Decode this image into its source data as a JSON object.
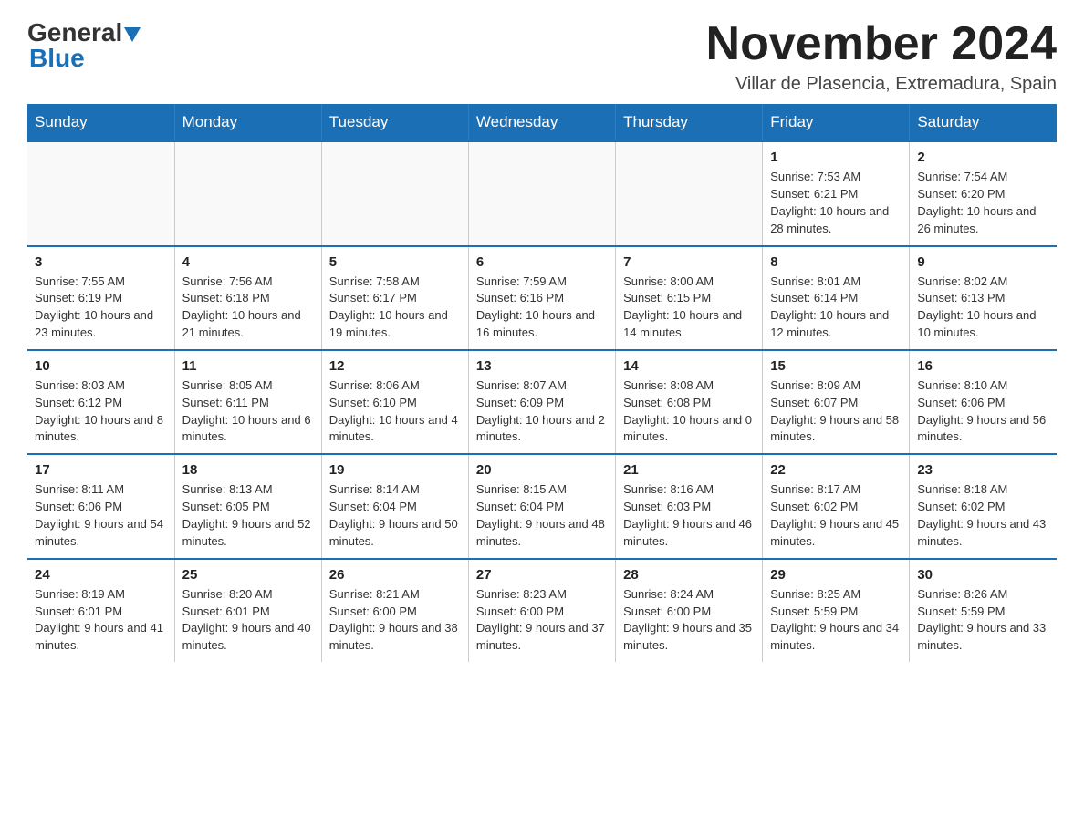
{
  "logo": {
    "general": "General",
    "blue": "Blue",
    "arrow": "▼"
  },
  "title": "November 2024",
  "location": "Villar de Plasencia, Extremadura, Spain",
  "weekdays": [
    "Sunday",
    "Monday",
    "Tuesday",
    "Wednesday",
    "Thursday",
    "Friday",
    "Saturday"
  ],
  "weeks": [
    [
      {
        "day": "",
        "info": ""
      },
      {
        "day": "",
        "info": ""
      },
      {
        "day": "",
        "info": ""
      },
      {
        "day": "",
        "info": ""
      },
      {
        "day": "",
        "info": ""
      },
      {
        "day": "1",
        "info": "Sunrise: 7:53 AM\nSunset: 6:21 PM\nDaylight: 10 hours and 28 minutes."
      },
      {
        "day": "2",
        "info": "Sunrise: 7:54 AM\nSunset: 6:20 PM\nDaylight: 10 hours and 26 minutes."
      }
    ],
    [
      {
        "day": "3",
        "info": "Sunrise: 7:55 AM\nSunset: 6:19 PM\nDaylight: 10 hours and 23 minutes."
      },
      {
        "day": "4",
        "info": "Sunrise: 7:56 AM\nSunset: 6:18 PM\nDaylight: 10 hours and 21 minutes."
      },
      {
        "day": "5",
        "info": "Sunrise: 7:58 AM\nSunset: 6:17 PM\nDaylight: 10 hours and 19 minutes."
      },
      {
        "day": "6",
        "info": "Sunrise: 7:59 AM\nSunset: 6:16 PM\nDaylight: 10 hours and 16 minutes."
      },
      {
        "day": "7",
        "info": "Sunrise: 8:00 AM\nSunset: 6:15 PM\nDaylight: 10 hours and 14 minutes."
      },
      {
        "day": "8",
        "info": "Sunrise: 8:01 AM\nSunset: 6:14 PM\nDaylight: 10 hours and 12 minutes."
      },
      {
        "day": "9",
        "info": "Sunrise: 8:02 AM\nSunset: 6:13 PM\nDaylight: 10 hours and 10 minutes."
      }
    ],
    [
      {
        "day": "10",
        "info": "Sunrise: 8:03 AM\nSunset: 6:12 PM\nDaylight: 10 hours and 8 minutes."
      },
      {
        "day": "11",
        "info": "Sunrise: 8:05 AM\nSunset: 6:11 PM\nDaylight: 10 hours and 6 minutes."
      },
      {
        "day": "12",
        "info": "Sunrise: 8:06 AM\nSunset: 6:10 PM\nDaylight: 10 hours and 4 minutes."
      },
      {
        "day": "13",
        "info": "Sunrise: 8:07 AM\nSunset: 6:09 PM\nDaylight: 10 hours and 2 minutes."
      },
      {
        "day": "14",
        "info": "Sunrise: 8:08 AM\nSunset: 6:08 PM\nDaylight: 10 hours and 0 minutes."
      },
      {
        "day": "15",
        "info": "Sunrise: 8:09 AM\nSunset: 6:07 PM\nDaylight: 9 hours and 58 minutes."
      },
      {
        "day": "16",
        "info": "Sunrise: 8:10 AM\nSunset: 6:06 PM\nDaylight: 9 hours and 56 minutes."
      }
    ],
    [
      {
        "day": "17",
        "info": "Sunrise: 8:11 AM\nSunset: 6:06 PM\nDaylight: 9 hours and 54 minutes."
      },
      {
        "day": "18",
        "info": "Sunrise: 8:13 AM\nSunset: 6:05 PM\nDaylight: 9 hours and 52 minutes."
      },
      {
        "day": "19",
        "info": "Sunrise: 8:14 AM\nSunset: 6:04 PM\nDaylight: 9 hours and 50 minutes."
      },
      {
        "day": "20",
        "info": "Sunrise: 8:15 AM\nSunset: 6:04 PM\nDaylight: 9 hours and 48 minutes."
      },
      {
        "day": "21",
        "info": "Sunrise: 8:16 AM\nSunset: 6:03 PM\nDaylight: 9 hours and 46 minutes."
      },
      {
        "day": "22",
        "info": "Sunrise: 8:17 AM\nSunset: 6:02 PM\nDaylight: 9 hours and 45 minutes."
      },
      {
        "day": "23",
        "info": "Sunrise: 8:18 AM\nSunset: 6:02 PM\nDaylight: 9 hours and 43 minutes."
      }
    ],
    [
      {
        "day": "24",
        "info": "Sunrise: 8:19 AM\nSunset: 6:01 PM\nDaylight: 9 hours and 41 minutes."
      },
      {
        "day": "25",
        "info": "Sunrise: 8:20 AM\nSunset: 6:01 PM\nDaylight: 9 hours and 40 minutes."
      },
      {
        "day": "26",
        "info": "Sunrise: 8:21 AM\nSunset: 6:00 PM\nDaylight: 9 hours and 38 minutes."
      },
      {
        "day": "27",
        "info": "Sunrise: 8:23 AM\nSunset: 6:00 PM\nDaylight: 9 hours and 37 minutes."
      },
      {
        "day": "28",
        "info": "Sunrise: 8:24 AM\nSunset: 6:00 PM\nDaylight: 9 hours and 35 minutes."
      },
      {
        "day": "29",
        "info": "Sunrise: 8:25 AM\nSunset: 5:59 PM\nDaylight: 9 hours and 34 minutes."
      },
      {
        "day": "30",
        "info": "Sunrise: 8:26 AM\nSunset: 5:59 PM\nDaylight: 9 hours and 33 minutes."
      }
    ]
  ]
}
